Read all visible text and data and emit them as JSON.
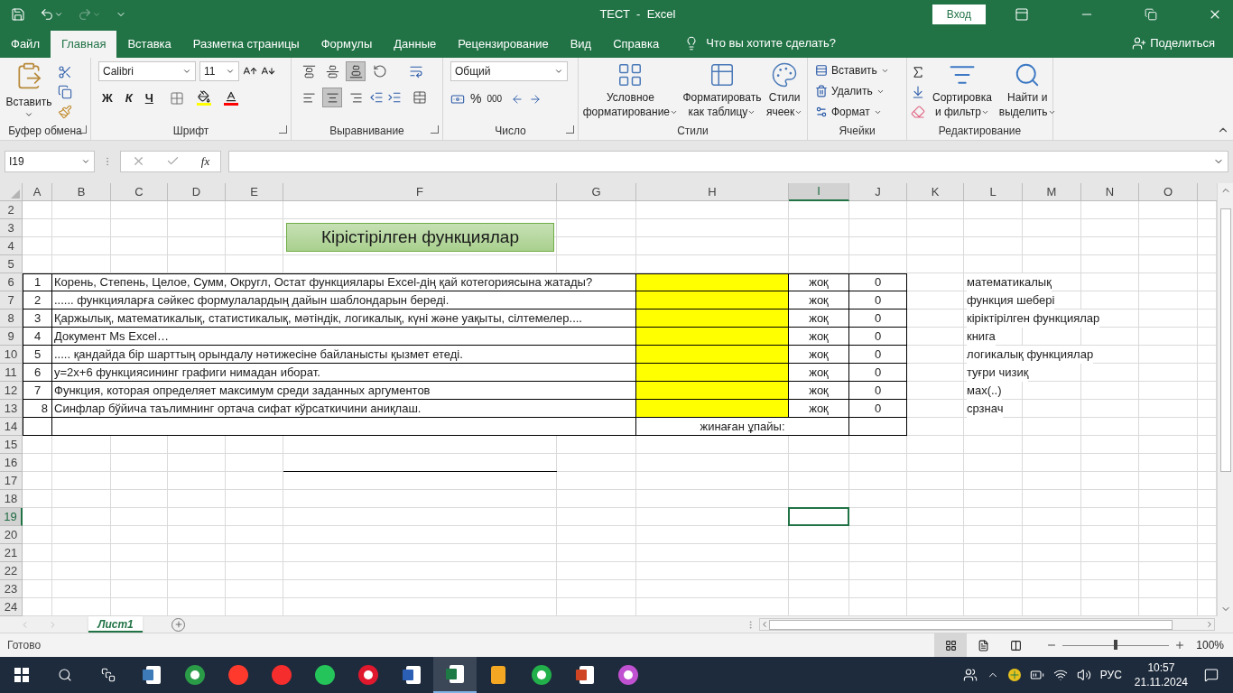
{
  "title_bar": {
    "title": "ТЕСТ  -  Excel",
    "sign_in": "Вход"
  },
  "ribbon_tabs": [
    {
      "label": "Файл",
      "selected": false
    },
    {
      "label": "Главная",
      "selected": true
    },
    {
      "label": "Вставка",
      "selected": false
    },
    {
      "label": "Разметка страницы",
      "selected": false
    },
    {
      "label": "Формулы",
      "selected": false
    },
    {
      "label": "Данные",
      "selected": false
    },
    {
      "label": "Рецензирование",
      "selected": false
    },
    {
      "label": "Вид",
      "selected": false
    },
    {
      "label": "Справка",
      "selected": false
    }
  ],
  "tell_me": "Что вы хотите сделать?",
  "share": "Поделиться",
  "clipboard": {
    "paste": "Вставить",
    "label": "Буфер обмена"
  },
  "font": {
    "name": "Calibri",
    "size": "11",
    "bold": "Ж",
    "italic": "К",
    "underline": "Ч",
    "label": "Шрифт"
  },
  "alignment": {
    "label": "Выравнивание",
    "vertical_align": [
      {
        "selected": false
      },
      {
        "selected": false
      },
      {
        "selected": true
      }
    ],
    "horizontal_align": [
      {
        "selected": false
      },
      {
        "selected": true
      },
      {
        "selected": false
      }
    ]
  },
  "number": {
    "format": "Общий",
    "percent": "%",
    "thousands": "000",
    "label": "Число"
  },
  "styles": {
    "label": "Стили",
    "buttons": [
      {
        "lines": [
          "Условное",
          "форматирование"
        ]
      },
      {
        "lines": [
          "Форматировать",
          "как таблицу"
        ]
      },
      {
        "lines": [
          "Стили",
          "ячеек"
        ]
      }
    ]
  },
  "cells": {
    "label": "Ячейки",
    "items": [
      "Вставить",
      "Удалить",
      "Формат"
    ]
  },
  "editing": {
    "label": "Редактирование",
    "buttons": [
      {
        "lines": [
          "Сортировка",
          "и фильтр"
        ]
      },
      {
        "lines": [
          "Найти и",
          "выделить"
        ]
      }
    ]
  },
  "formula_bar": {
    "name_box": "I19",
    "fx": "fx"
  },
  "sheet": {
    "columns": [
      {
        "label": "A",
        "selected": false
      },
      {
        "label": "B",
        "selected": false
      },
      {
        "label": "C",
        "selected": false
      },
      {
        "label": "D",
        "selected": false
      },
      {
        "label": "E",
        "selected": false
      },
      {
        "label": "F",
        "selected": false
      },
      {
        "label": "G",
        "selected": false
      },
      {
        "label": "H",
        "selected": false
      },
      {
        "label": "I",
        "selected": true
      },
      {
        "label": "J",
        "selected": false
      },
      {
        "label": "K",
        "selected": false
      },
      {
        "label": "L",
        "selected": false
      },
      {
        "label": "M",
        "selected": false
      },
      {
        "label": "N",
        "selected": false
      },
      {
        "label": "O",
        "selected": false
      }
    ],
    "rows": [
      {
        "label": "2",
        "selected": false
      },
      {
        "label": "3",
        "selected": false
      },
      {
        "label": "4",
        "selected": false
      },
      {
        "label": "5",
        "selected": false
      },
      {
        "label": "6",
        "selected": false
      },
      {
        "label": "7",
        "selected": false
      },
      {
        "label": "8",
        "selected": false
      },
      {
        "label": "9",
        "selected": false
      },
      {
        "label": "10",
        "selected": false
      },
      {
        "label": "11",
        "selected": false
      },
      {
        "label": "12",
        "selected": false
      },
      {
        "label": "13",
        "selected": false
      },
      {
        "label": "14",
        "selected": false
      },
      {
        "label": "15",
        "selected": false
      },
      {
        "label": "16",
        "selected": false
      },
      {
        "label": "17",
        "selected": false
      },
      {
        "label": "18",
        "selected": false
      },
      {
        "label": "19",
        "selected": true
      },
      {
        "label": "20",
        "selected": false
      },
      {
        "label": "21",
        "selected": false
      },
      {
        "label": "22",
        "selected": false
      },
      {
        "label": "23",
        "selected": false
      },
      {
        "label": "24",
        "selected": false
      }
    ],
    "title": "Кірістірілген функциялар",
    "questions": [
      {
        "number": "1",
        "kind": "text",
        "text": "Корень, Степень, Целое, Сумм, Округл, Остат функциялары  Excel-дің қай котегориясына жатады?",
        "status": "жоқ",
        "score": "0",
        "answer": "математикалық"
      },
      {
        "number": "2",
        "kind": "text",
        "text": "......  функцияларға сәйкес формулалардың дайын шаблондарын береді.",
        "status": "жоқ",
        "score": "0",
        "answer": "функция шебері"
      },
      {
        "number": "3",
        "kind": "text",
        "text": "Қаржылық, математикалық, статистикалық, мәтіндік, логикалық, күні және уақыты, сілтемелер....",
        "status": "жоқ",
        "score": "0",
        "answer": "кіріктірілген  функциялар"
      },
      {
        "number": "4",
        "kind": "text",
        "text": "Документ Ms Excel…",
        "status": "жоқ",
        "score": "0",
        "answer": "книга"
      },
      {
        "number": "5",
        "kind": "text",
        "text": "..... қандайда бір шарттың орындалу нәтижесіне байланысты қызмет етеді.",
        "status": "жоқ",
        "score": "0",
        "answer": "логикалық функциялар"
      },
      {
        "number": "6",
        "kind": "text",
        "text": "y=2x+6  функциясининг графиги нимадан иборат.",
        "status": "жоқ",
        "score": "0",
        "answer": "туғри чизиқ"
      },
      {
        "number": "7",
        "kind": "text",
        "text": "Функция, которая определяет максимум среди заданных аргументов",
        "status": "жоқ",
        "score": "0",
        "answer": "мах(..)"
      },
      {
        "number": "8",
        "kind": "number",
        "text": "Синфлар бўйича таълимнинг ортача сифат кўрсаткичини аниқлаш.",
        "status": "жоқ",
        "score": "0",
        "answer": "срзнач"
      }
    ],
    "total_label": "жинаған ұпайы:"
  },
  "sheet_tabs": [
    {
      "label": "Лист1",
      "selected": true
    }
  ],
  "status_bar": {
    "status": "Готово",
    "zoom": "100%",
    "level": 0.5
  },
  "taskbar": {
    "language": "РУС",
    "time": "10:57",
    "date": "21.11.2024"
  }
}
